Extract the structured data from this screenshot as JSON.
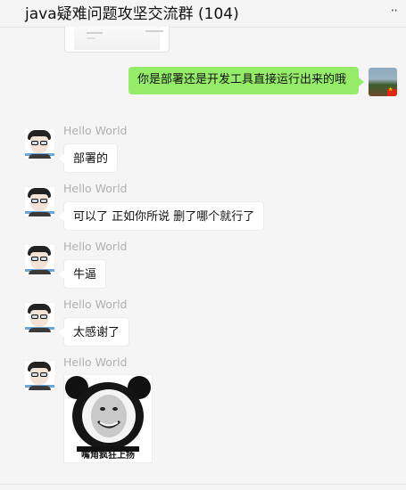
{
  "window": {
    "title": "java疑难问题攻坚交流群 (104)"
  },
  "header": {
    "more_label": "··"
  },
  "messages": {
    "mine": {
      "text": "你是部署还是开发工具直接运行出来的哦"
    },
    "others": [
      {
        "sender": "Hello World",
        "text": "部署的"
      },
      {
        "sender": "Hello World",
        "text": "可以了 正如你所说 删了哪个就行了"
      },
      {
        "sender": "Hello World",
        "text": "牛逼"
      },
      {
        "sender": "Hello World",
        "text": "太感谢了"
      },
      {
        "sender": "Hello World",
        "sticker_caption": "嘴角疯狂上扬"
      }
    ]
  },
  "colors": {
    "my_bubble": "#95ec69",
    "background": "#f5f5f5",
    "sender_name": "#b0b0b0"
  }
}
